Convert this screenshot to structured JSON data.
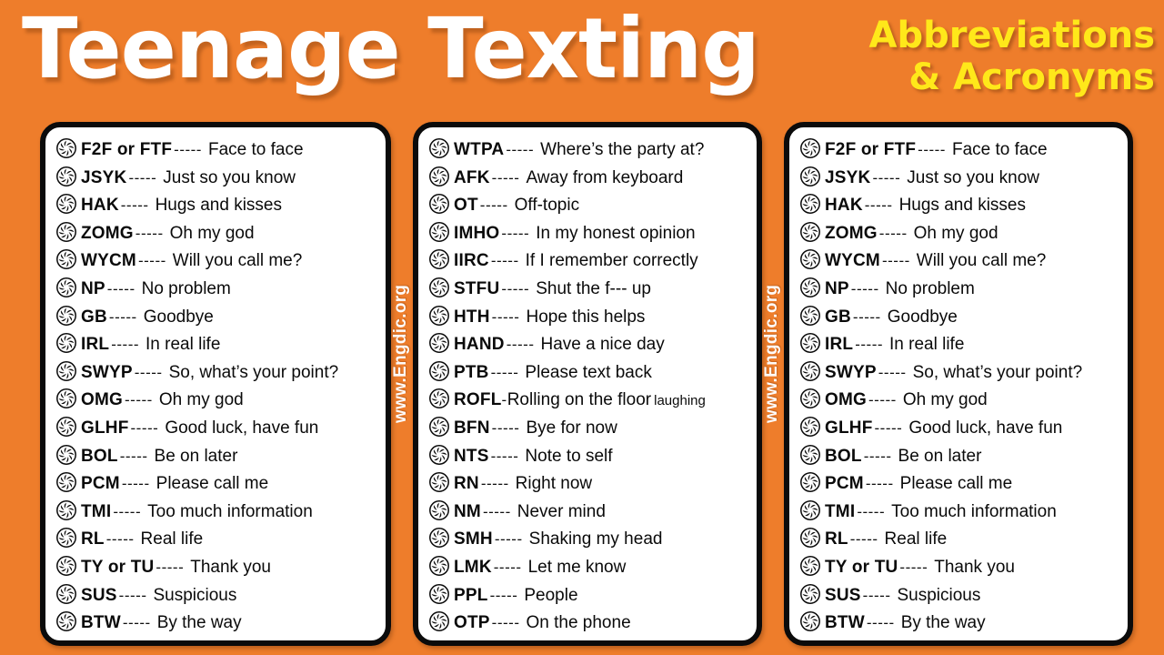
{
  "theme": {
    "background": "#EE7D2B",
    "card_background": "#FFFFFF",
    "card_border": "#0B0B0B",
    "title_color": "#FFFFFF",
    "subtitle_color": "#FFE81A",
    "text_color": "#0A0A0A"
  },
  "header": {
    "title": "Teenage Texting",
    "subtitle_line1": "Abbreviations",
    "subtitle_line2": "& Acronyms"
  },
  "watermark": {
    "text": "www.Engdic.org"
  },
  "bullet_icon": "pinwheel-rosette-icon",
  "separator": "-----",
  "columns": [
    {
      "id": "column-1",
      "entries": [
        {
          "abbr": "F2F or FTF",
          "sep": "-----",
          "meaning": "Face to face"
        },
        {
          "abbr": "JSYK",
          "sep": "-----",
          "meaning": "Just so you know"
        },
        {
          "abbr": "HAK",
          "sep": "-----",
          "meaning": "Hugs and kisses"
        },
        {
          "abbr": "ZOMG",
          "sep": "-----",
          "meaning": "Oh my god"
        },
        {
          "abbr": "WYCM",
          "sep": "-----",
          "meaning": "Will you call me?"
        },
        {
          "abbr": "NP",
          "sep": "-----",
          "meaning": "No problem"
        },
        {
          "abbr": "GB",
          "sep": "-----",
          "meaning": "Goodbye"
        },
        {
          "abbr": "IRL",
          "sep": "-----",
          "meaning": "In real life"
        },
        {
          "abbr": "SWYP",
          "sep": "-----",
          "meaning": "So, what’s your point?"
        },
        {
          "abbr": "OMG",
          "sep": "-----",
          "meaning": "Oh my god"
        },
        {
          "abbr": "GLHF",
          "sep": "-----",
          "meaning": "Good luck, have fun"
        },
        {
          "abbr": "BOL",
          "sep": "-----",
          "meaning": "Be on later"
        },
        {
          "abbr": "PCM",
          "sep": "-----",
          "meaning": "Please call me"
        },
        {
          "abbr": "TMI",
          "sep": "-----",
          "meaning": "Too much information"
        },
        {
          "abbr": "RL",
          "sep": "-----",
          "meaning": "Real life"
        },
        {
          "abbr": "TY or TU",
          "sep": "-----",
          "meaning": "Thank you"
        },
        {
          "abbr": "SUS",
          "sep": "-----",
          "meaning": "Suspicious"
        },
        {
          "abbr": "BTW",
          "sep": "-----",
          "meaning": "By the way"
        }
      ]
    },
    {
      "id": "column-2",
      "entries": [
        {
          "abbr": "WTPA",
          "sep": "-----",
          "meaning": "Where’s the party at?"
        },
        {
          "abbr": "AFK",
          "sep": "-----",
          "meaning": "Away from keyboard"
        },
        {
          "abbr": "OT",
          "sep": "-----",
          "meaning": "Off-topic"
        },
        {
          "abbr": "IMHO",
          "sep": "-----",
          "meaning": "In my honest opinion"
        },
        {
          "abbr": "IIRC",
          "sep": "-----",
          "meaning": "If I remember correctly"
        },
        {
          "abbr": "STFU",
          "sep": "-----",
          "meaning": "Shut the f--- up"
        },
        {
          "abbr": "HTH",
          "sep": "-----",
          "meaning": "Hope this helps"
        },
        {
          "abbr": "HAND",
          "sep": "-----",
          "meaning": "Have a nice day"
        },
        {
          "abbr": "PTB",
          "sep": "-----",
          "meaning": "Please text back"
        },
        {
          "abbr": "ROFL",
          "sep": "-",
          "meaning": "Rolling on the floor",
          "meaning_small": "laughing",
          "tight": true
        },
        {
          "abbr": "BFN",
          "sep": "-----",
          "meaning": "Bye for now"
        },
        {
          "abbr": "NTS",
          "sep": "-----",
          "meaning": "Note to self"
        },
        {
          "abbr": "RN",
          "sep": "-----",
          "meaning": "Right now"
        },
        {
          "abbr": "NM",
          "sep": "-----",
          "meaning": "Never mind"
        },
        {
          "abbr": "SMH",
          "sep": "-----",
          "meaning": "Shaking my head"
        },
        {
          "abbr": "LMK",
          "sep": "-----",
          "meaning": "Let me know"
        },
        {
          "abbr": "PPL",
          "sep": "-----",
          "meaning": "People"
        },
        {
          "abbr": "OTP",
          "sep": "-----",
          "meaning": "On the phone"
        }
      ]
    },
    {
      "id": "column-3",
      "entries": [
        {
          "abbr": "F2F or FTF",
          "sep": "-----",
          "meaning": "Face to face"
        },
        {
          "abbr": "JSYK",
          "sep": "-----",
          "meaning": "Just so you know"
        },
        {
          "abbr": "HAK",
          "sep": "-----",
          "meaning": "Hugs and kisses"
        },
        {
          "abbr": "ZOMG",
          "sep": "-----",
          "meaning": "Oh my god"
        },
        {
          "abbr": "WYCM",
          "sep": "-----",
          "meaning": "Will you call me?"
        },
        {
          "abbr": "NP",
          "sep": "-----",
          "meaning": "No problem"
        },
        {
          "abbr": "GB",
          "sep": "-----",
          "meaning": "Goodbye"
        },
        {
          "abbr": "IRL",
          "sep": "-----",
          "meaning": "In real life"
        },
        {
          "abbr": "SWYP",
          "sep": "-----",
          "meaning": "So, what’s your point?"
        },
        {
          "abbr": "OMG",
          "sep": "-----",
          "meaning": "Oh my god"
        },
        {
          "abbr": "GLHF",
          "sep": "-----",
          "meaning": "Good luck, have fun"
        },
        {
          "abbr": "BOL",
          "sep": "-----",
          "meaning": "Be on later"
        },
        {
          "abbr": "PCM",
          "sep": "-----",
          "meaning": "Please call me"
        },
        {
          "abbr": "TMI",
          "sep": "-----",
          "meaning": "Too much information"
        },
        {
          "abbr": "RL",
          "sep": "-----",
          "meaning": "Real life"
        },
        {
          "abbr": "TY or TU",
          "sep": "-----",
          "meaning": "Thank you"
        },
        {
          "abbr": "SUS",
          "sep": "-----",
          "meaning": "Suspicious"
        },
        {
          "abbr": "BTW",
          "sep": "-----",
          "meaning": "By the way"
        }
      ]
    }
  ]
}
